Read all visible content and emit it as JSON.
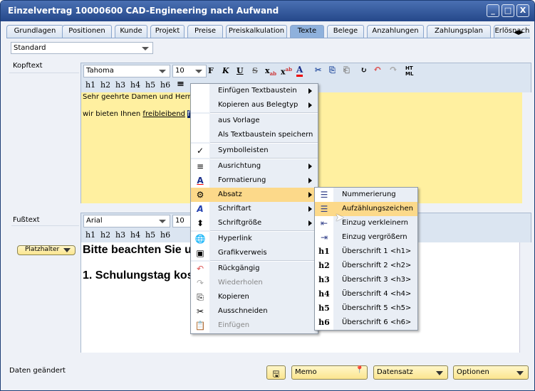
{
  "window": {
    "title": "Einzelvertrag 10000600 CAD-Engineering nach Aufwand",
    "minimize": "_",
    "maximize": "□",
    "close": "X"
  },
  "tabs": [
    {
      "label": "Grundlagen"
    },
    {
      "label": "Positionen"
    },
    {
      "label": "Kunde"
    },
    {
      "label": "Projekt"
    },
    {
      "label": "Preise"
    },
    {
      "label": "Preiskalkulation"
    },
    {
      "label": "Texte",
      "active": true
    },
    {
      "label": "Belege"
    },
    {
      "label": "Anzahlungen"
    },
    {
      "label": "Zahlungsplan"
    },
    {
      "label": "Erlösnachw"
    }
  ],
  "template_select": "Standard",
  "kopftext": {
    "label": "Kopftext",
    "font": "Tahoma",
    "size": "10",
    "line1": "Sehr geehrte Damen und Herren,",
    "line2_pre": "wir bieten Ihnen ",
    "line2_link": "freibleibend",
    "line2_sel": "folge",
    "bg": "#fff0a0"
  },
  "fusstext": {
    "label": "Fußtext",
    "font": "Arial",
    "size": "10",
    "placeholder_btn": "Platzhalter",
    "line1": "Bitte beachten Sie u",
    "line2": "1. Schulungstag kos"
  },
  "heading_buttons": [
    "h1",
    "h2",
    "h3",
    "h4",
    "h5",
    "h6"
  ],
  "format_buttons": {
    "bold": "F",
    "italic": "K",
    "underline": "U",
    "strike": "S",
    "html": "HT ML"
  },
  "context_menu": [
    {
      "label": "Einfügen Textbaustein",
      "submenu": true
    },
    {
      "label": "Kopieren aus Belegtyp",
      "submenu": true
    },
    {
      "sep": true
    },
    {
      "label": "aus Vorlage"
    },
    {
      "label": "Als Textbaustein speichern"
    },
    {
      "sep": true
    },
    {
      "label": "Symbolleisten",
      "icon": "check-icon",
      "glyph": "✓"
    },
    {
      "sep": true
    },
    {
      "label": "Ausrichtung",
      "icon": "align-icon",
      "glyph": "≡",
      "submenu": true
    },
    {
      "label": "Formatierung",
      "icon": "font-color-icon",
      "glyph": "A",
      "submenu": true
    },
    {
      "label": "Absatz",
      "icon": "paragraph-settings-icon",
      "glyph": "⚙",
      "submenu": true,
      "highlighted": true
    },
    {
      "label": "Schriftart",
      "icon": "font-icon",
      "glyph": "A",
      "submenu": true
    },
    {
      "label": "Schriftgröße",
      "icon": "font-size-icon",
      "glyph": "⬍",
      "submenu": true
    },
    {
      "sep": true
    },
    {
      "label": "Hyperlink",
      "icon": "hyperlink-icon",
      "glyph": "🌐"
    },
    {
      "label": "Grafikverweis",
      "icon": "image-icon",
      "glyph": "▣"
    },
    {
      "sep": true
    },
    {
      "label": "Rückgängig",
      "icon": "undo-icon",
      "glyph": "↶"
    },
    {
      "label": "Wiederholen",
      "icon": "redo-icon",
      "glyph": "↷",
      "disabled": true
    },
    {
      "label": "Kopieren",
      "icon": "copy-icon",
      "glyph": "⎘"
    },
    {
      "label": "Ausschneiden",
      "icon": "cut-icon",
      "glyph": "✂"
    },
    {
      "label": "Einfügen",
      "icon": "paste-icon",
      "glyph": "📋",
      "disabled": true
    }
  ],
  "submenu": [
    {
      "label": "Nummerierung",
      "icon": "numbered-list-icon",
      "glyph": "☰"
    },
    {
      "label": "Aufzählungszeichen",
      "icon": "bullet-list-icon",
      "glyph": "☰",
      "highlighted": true
    },
    {
      "label": "Einzug verkleinern",
      "icon": "outdent-icon",
      "glyph": "⇤"
    },
    {
      "label": "Einzug vergrößern",
      "icon": "indent-icon",
      "glyph": "⇥"
    },
    {
      "label": "Überschrift 1 <h1>",
      "icon": "h1-icon",
      "glyph": "h1"
    },
    {
      "label": "Überschrift 2 <h2>",
      "icon": "h2-icon",
      "glyph": "h2"
    },
    {
      "label": "Überschrift 3 <h3>",
      "icon": "h3-icon",
      "glyph": "h3"
    },
    {
      "label": "Überschrift 4 <h4>",
      "icon": "h4-icon",
      "glyph": "h4"
    },
    {
      "label": "Überschrift 5 <h5>",
      "icon": "h5-icon",
      "glyph": "h5"
    },
    {
      "label": "Überschrift 6 <h6>",
      "icon": "h6-icon",
      "glyph": "h6"
    }
  ],
  "status": "Daten geändert",
  "footer": {
    "memo": "Memo",
    "datensatz": "Datensatz",
    "optionen": "Optionen"
  }
}
